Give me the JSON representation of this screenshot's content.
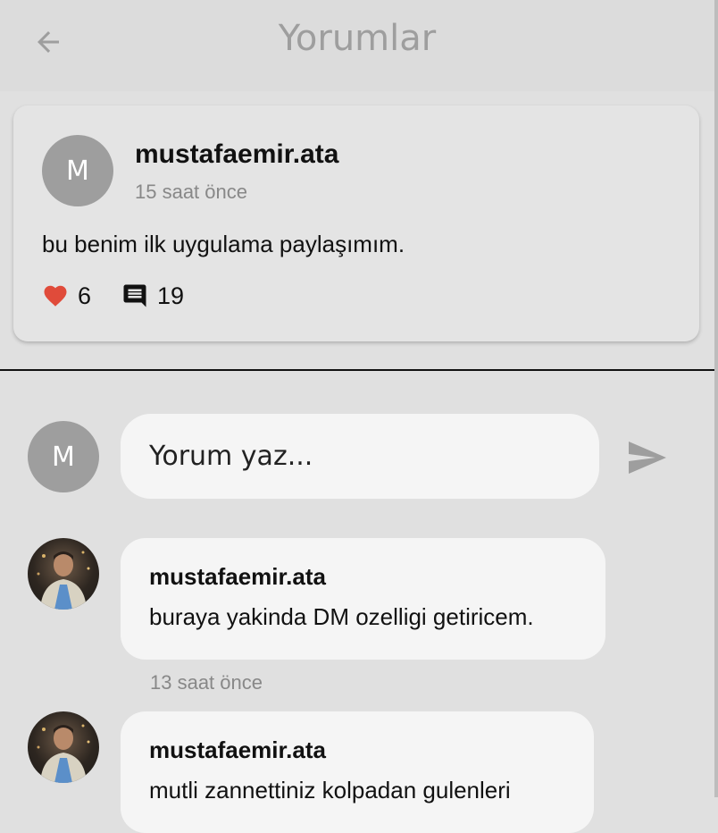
{
  "header": {
    "title": "Yorumlar"
  },
  "post": {
    "avatar_initial": "M",
    "username": "mustafaemir.ata",
    "time": "15 saat önce",
    "text": "bu benim ilk uygulama paylaşımım.",
    "likes": "6",
    "comments_count": "19",
    "colors": {
      "heart": "#e04b3a"
    }
  },
  "comment_input": {
    "avatar_initial": "M",
    "placeholder": "Yorum yaz..."
  },
  "comments": [
    {
      "username": "mustafaemir.ata",
      "text": "buraya yakinda DM ozelligi getiricem.",
      "time": "13 saat önce"
    },
    {
      "username": "mustafaemir.ata",
      "text": "mutli zannettiniz kolpadan gulenleri",
      "time": ""
    }
  ]
}
